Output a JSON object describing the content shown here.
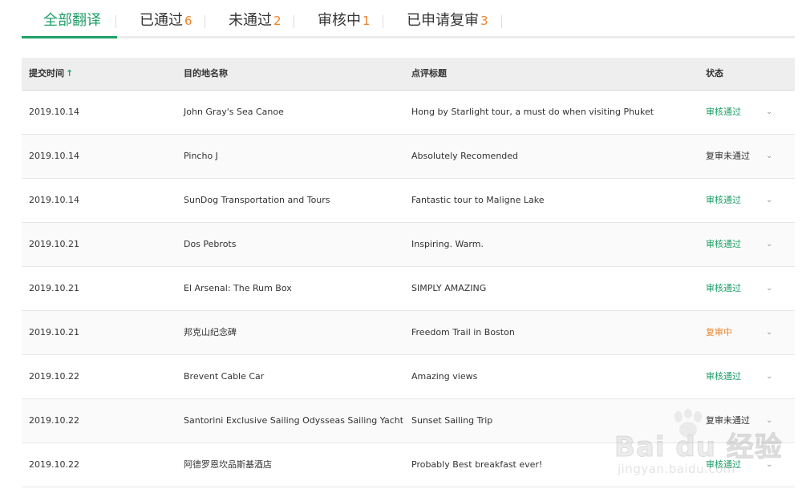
{
  "tabs": [
    {
      "label": "全部翻译",
      "count": ""
    },
    {
      "label": "已通过",
      "count": "6"
    },
    {
      "label": "未通过",
      "count": "2"
    },
    {
      "label": "审核中",
      "count": "1"
    },
    {
      "label": "已申请复审",
      "count": "3"
    }
  ],
  "table": {
    "headers": {
      "date": "提交时间",
      "sort_icon": "arrow-up-icon",
      "destination": "目的地名称",
      "title": "点评标题",
      "status": "状态"
    },
    "rows": [
      {
        "date": "2019.10.14",
        "destination": "John Gray's Sea Canoe",
        "title": "Hong by Starlight tour, a must do when visiting Phuket",
        "status": "审核通过",
        "status_color": "#1fa067"
      },
      {
        "date": "2019.10.14",
        "destination": "Pincho J",
        "title": "Absolutely Recomended",
        "status": "复审未通过",
        "status_color": "#333333"
      },
      {
        "date": "2019.10.14",
        "destination": "SunDog Transportation and Tours",
        "title": "Fantastic tour to Maligne Lake",
        "status": "审核通过",
        "status_color": "#1fa067"
      },
      {
        "date": "2019.10.21",
        "destination": "Dos Pebrots",
        "title": "Inspiring. Warm.",
        "status": "审核通过",
        "status_color": "#1fa067"
      },
      {
        "date": "2019.10.21",
        "destination": "El Arsenal: The Rum Box",
        "title": "SIMPLY AMAZING",
        "status": "审核通过",
        "status_color": "#1fa067"
      },
      {
        "date": "2019.10.21",
        "destination": "邦克山纪念碑",
        "title": "Freedom Trail in Boston",
        "status": "复审中",
        "status_color": "#f0832b"
      },
      {
        "date": "2019.10.22",
        "destination": "Brevent Cable Car",
        "title": "Amazing views",
        "status": "审核通过",
        "status_color": "#1fa067"
      },
      {
        "date": "2019.10.22",
        "destination": "Santorini Exclusive Sailing Odysseas Sailing Yacht",
        "title": "Sunset Sailing Trip",
        "status": "复审未通过",
        "status_color": "#333333"
      },
      {
        "date": "2019.10.22",
        "destination": "阿德罗恩坎品斯基酒店",
        "title": "Probably Best breakfast ever!",
        "status": "审核通过",
        "status_color": "#1fa067"
      }
    ]
  },
  "watermark": {
    "logo": "Bai du 经验",
    "url": "jingyan.baidu.com"
  },
  "colors": {
    "accent": "#1fa067",
    "count": "#f0832b"
  }
}
